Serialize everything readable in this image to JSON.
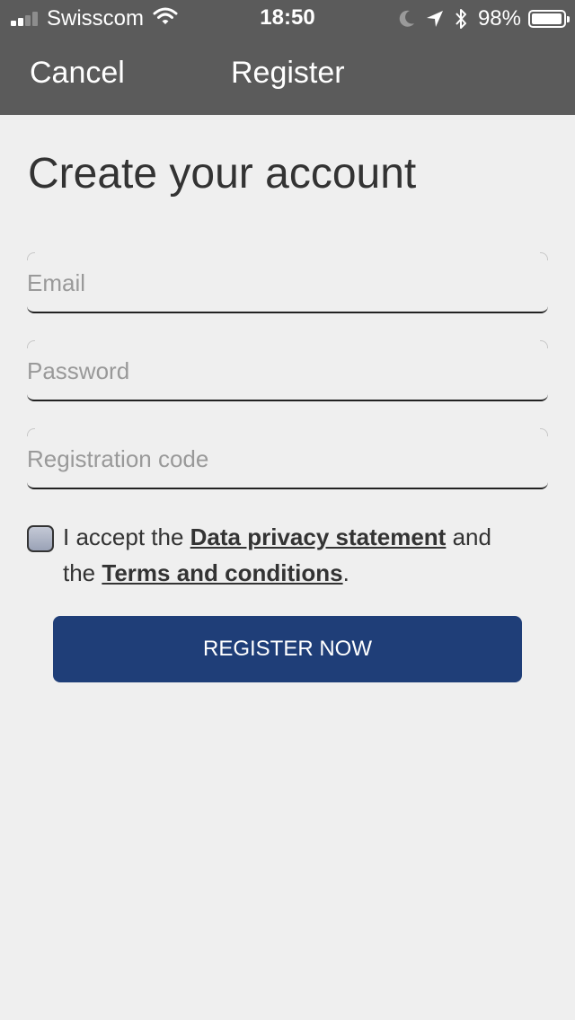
{
  "status_bar": {
    "carrier": "Swisscom",
    "time": "18:50",
    "battery_percent": "98%",
    "signal_bars_filled": 2,
    "signal_bars_total": 4,
    "battery_level": 0.98
  },
  "nav": {
    "cancel_label": "Cancel",
    "title": "Register"
  },
  "page": {
    "heading": "Create your account"
  },
  "form": {
    "email": {
      "placeholder": "Email",
      "value": ""
    },
    "password": {
      "placeholder": "Password",
      "value": ""
    },
    "registration_code": {
      "placeholder": "Registration code",
      "value": ""
    }
  },
  "consent": {
    "checked": false,
    "text_before": "I accept the ",
    "privacy_link": "Data privacy statement",
    "text_middle": " and the ",
    "terms_link": "Terms and conditions",
    "text_after": "."
  },
  "actions": {
    "register_label": "REGISTER NOW"
  },
  "colors": {
    "header_bg": "#5b5b5b",
    "page_bg": "#efefef",
    "primary_button": "#1f3e78",
    "text": "#333333"
  },
  "icons": {
    "signal": "signal-bars-icon",
    "wifi": "wifi-icon",
    "moon": "moon-icon",
    "location": "location-arrow-icon",
    "bluetooth": "bluetooth-icon",
    "battery": "battery-icon"
  }
}
